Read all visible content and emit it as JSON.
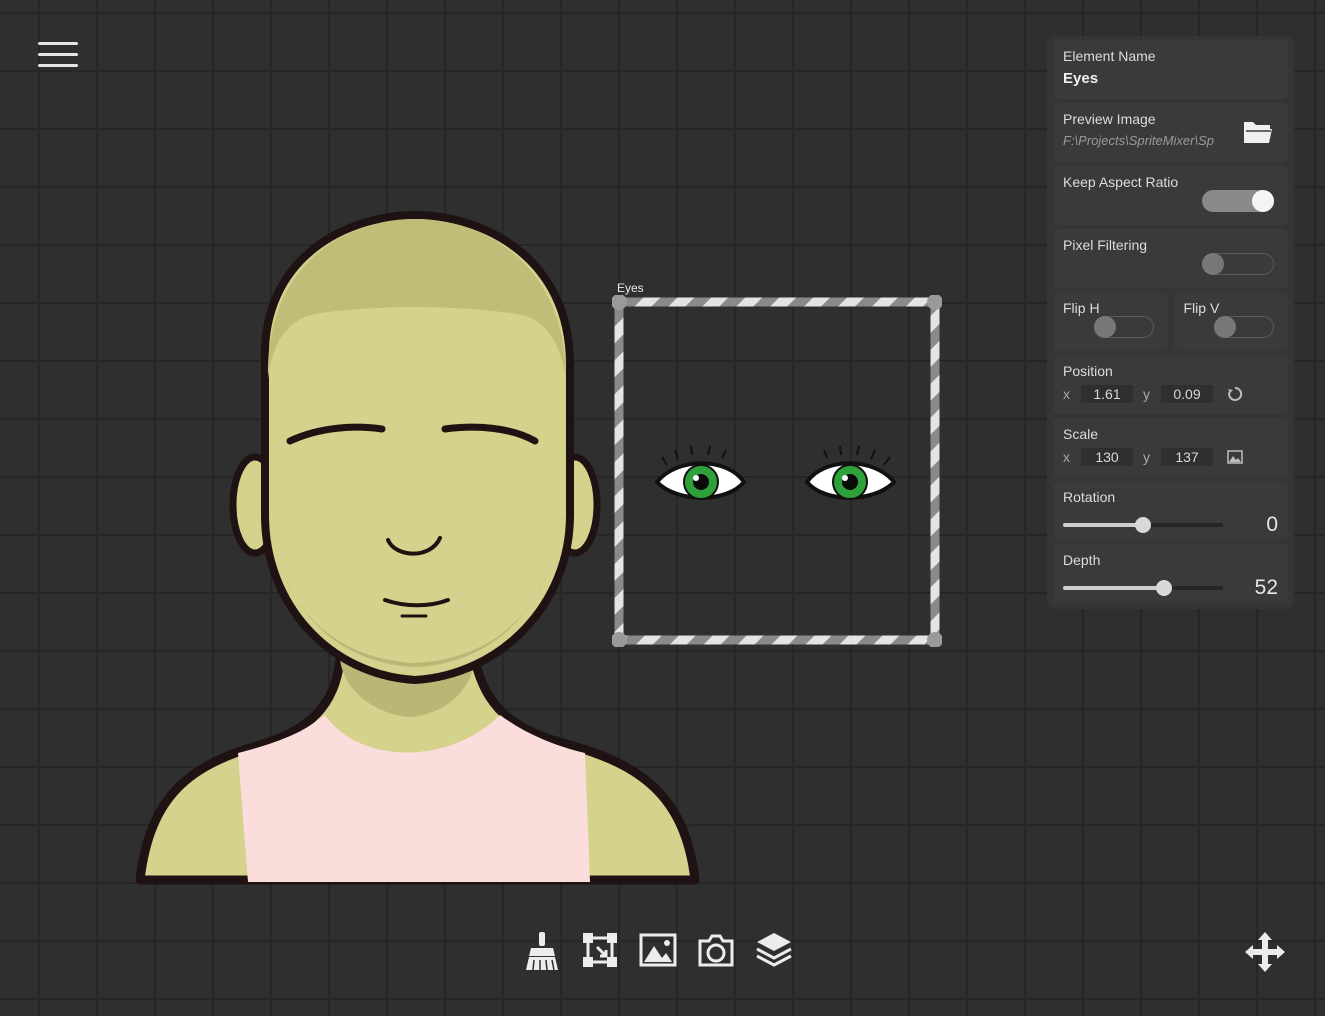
{
  "canvas": {
    "selection_label": "Eyes"
  },
  "inspector": {
    "element_name": {
      "label": "Element Name",
      "value": "Eyes"
    },
    "preview_image": {
      "label": "Preview Image",
      "path": "F:\\Projects\\SpriteMixer\\Sp",
      "icon": "folder-icon"
    },
    "keep_aspect_ratio": {
      "label": "Keep Aspect Ratio",
      "on": true
    },
    "pixel_filtering": {
      "label": "Pixel Filtering",
      "on": false
    },
    "flip_h": {
      "label": "Flip H",
      "on": false
    },
    "flip_v": {
      "label": "Flip V",
      "on": false
    },
    "position": {
      "label": "Position",
      "x_label": "x",
      "y_label": "y",
      "x": "1.61",
      "y": "0.09",
      "icon": "reset-icon"
    },
    "scale": {
      "label": "Scale",
      "x_label": "x",
      "y_label": "y",
      "x": "130",
      "y": "137",
      "icon": "image-icon"
    },
    "rotation": {
      "label": "Rotation",
      "value": "0",
      "fraction": 0.5
    },
    "depth": {
      "label": "Depth",
      "value": "52",
      "fraction": 0.63
    }
  },
  "toolbar": {
    "tools": [
      "brush-icon",
      "transform-icon",
      "image-icon",
      "camera-icon",
      "layers-icon"
    ],
    "move": "move-icon"
  },
  "colors": {
    "background": "#2f2f2f",
    "skin": "#d4d28c",
    "shirt": "#fbdddb",
    "eye_iris": "#2fa13a"
  }
}
